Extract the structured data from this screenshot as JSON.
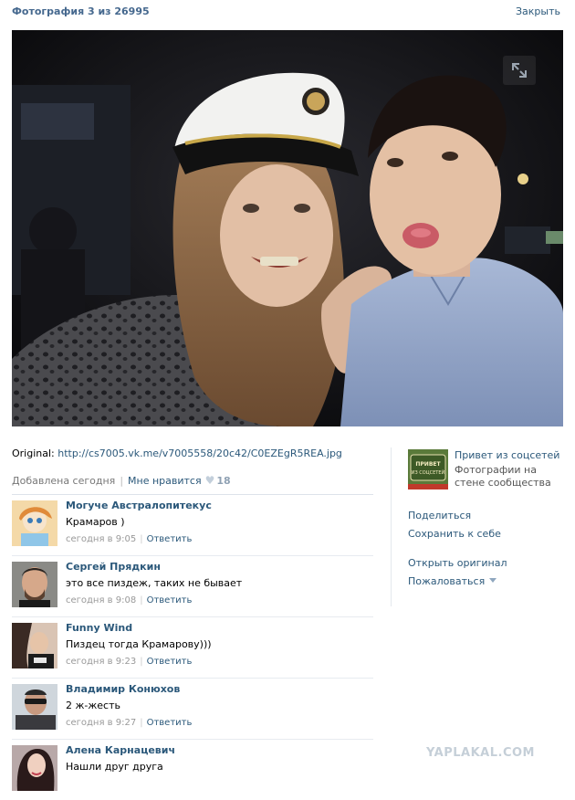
{
  "header": {
    "title": "Фотография 3 из 26995",
    "close_label": "Закрыть"
  },
  "photo": {},
  "info": {
    "original_label": "Original:",
    "original_link": "http://cs7005.vk.me/v7005558/20c42/C0EZEgR5REA.jpg",
    "added": "Добавлена сегодня",
    "like_label": "Мне нравится",
    "like_count": "18"
  },
  "comments": [
    {
      "author": "Могуче Австралопитекус",
      "text": "Крамаров )",
      "time": "сегодня в 9:05",
      "reply": "Ответить"
    },
    {
      "author": "Сергей Прядкин",
      "text": "это все пиздеж, таких не бывает",
      "time": "сегодня в 9:08",
      "reply": "Ответить"
    },
    {
      "author": "Funny Wind",
      "text": "Пиздец тогда Крамарову)))",
      "time": "сегодня в 9:23",
      "reply": "Ответить"
    },
    {
      "author": "Владимир Конюхов",
      "text": "2 ж-жесть",
      "time": "сегодня в 9:27",
      "reply": "Ответить"
    },
    {
      "author": "Алена Карнацевич",
      "text": "Нашли друг друга",
      "time": "",
      "reply": ""
    }
  ],
  "sidebar": {
    "album_title": "Привет из соцсетей",
    "album_subtitle": "Фотографии на стене сообщества",
    "album_thumb_text": "ПРИВЕТ ИЗ СОЦСЕТЕЙ",
    "share": "Поделиться",
    "save": "Сохранить к себе",
    "open_original": "Открыть оригинал",
    "report": "Пожаловаться"
  },
  "watermark": "YAPLAKAL.COM"
}
